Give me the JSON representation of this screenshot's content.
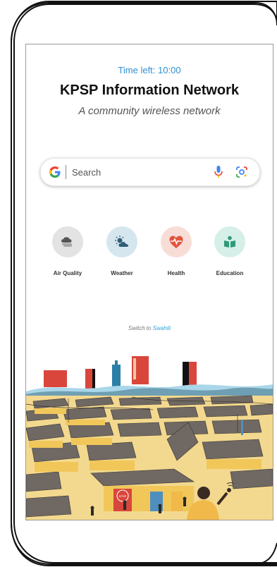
{
  "timer": {
    "text": "Time left: 10:00"
  },
  "header": {
    "title": "KPSP Information Network",
    "subtitle": "A community wireless network"
  },
  "search": {
    "placeholder": "Search",
    "value": ""
  },
  "tiles": [
    {
      "label": "Air Quality",
      "icon": "cloud-icon",
      "bg": "#e3e3e3"
    },
    {
      "label": "Weather",
      "icon": "sun-cloud-icon",
      "bg": "#d5e6ee"
    },
    {
      "label": "Health",
      "icon": "heart-pulse-icon",
      "bg": "#f8ddd7"
    },
    {
      "label": "Education",
      "icon": "book-icon",
      "bg": "#d6efe8"
    }
  ],
  "language": {
    "prefix": "Switch to ",
    "link": "Swahili"
  },
  "illustration": {
    "sign_text": "KPSP"
  },
  "colors": {
    "accent": "#2d8fd0",
    "link": "#2aa6d6"
  }
}
